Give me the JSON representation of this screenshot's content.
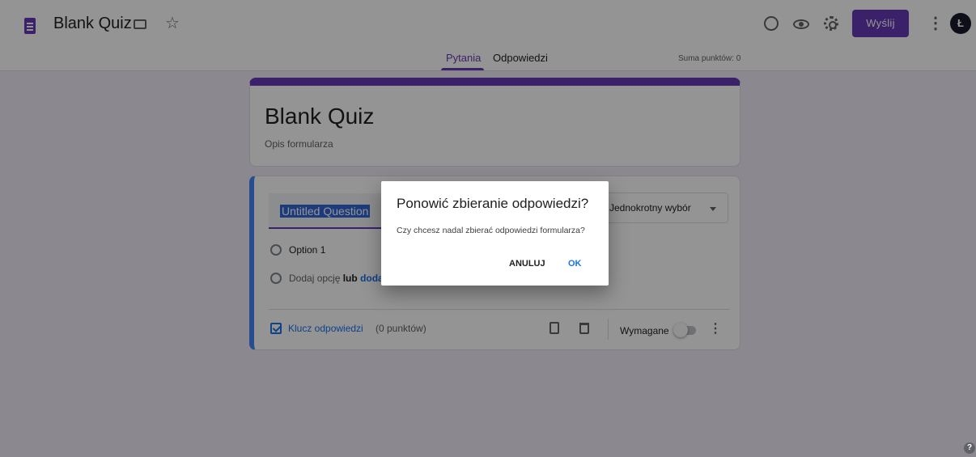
{
  "header": {
    "doc_title": "Blank Quiz",
    "star_glyph": "☆",
    "more_glyph": "⋮",
    "send_label": "Wyślij",
    "avatar_letter": "Ł",
    "accent": "#673ab7"
  },
  "tabs": {
    "questions": "Pytania",
    "answers": "Odpowiedzi",
    "points_total": "Suma punktów: 0"
  },
  "form": {
    "title": "Blank Quiz",
    "description": "Opis formularza"
  },
  "question": {
    "title": "Untitled Question",
    "type": "Jednokrotny wybór",
    "options": [
      "Option 1"
    ],
    "add_option_text": "Dodaj opcję",
    "add_option_or": "lub",
    "add_other_text": "dodaj „Inne”",
    "answer_key_label": "Klucz odpowiedzi",
    "points_label": "(0 punktów)",
    "required_label": "Wymagane",
    "required_on": false,
    "more_glyph": "⋮"
  },
  "dialog": {
    "title": "Ponowić zbieranie odpowiedzi?",
    "body": "Czy chcesz nadal zbierać odpowiedzi formularza?",
    "cancel_label": "ANULUJ",
    "ok_label": "OK"
  },
  "help": {
    "glyph": "?"
  }
}
